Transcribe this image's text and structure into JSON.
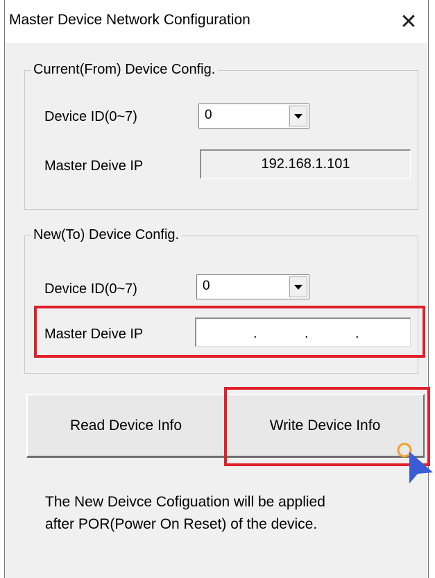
{
  "window": {
    "title": "Master Device Network Configuration",
    "close_glyph": "✕"
  },
  "current_group": {
    "legend": "Current(From) Device Config.",
    "device_id_label": "Device ID(0~7)",
    "device_id_value": "0",
    "master_ip_label": "Master Deive IP",
    "master_ip_value": "192.168.1.101"
  },
  "new_group": {
    "legend": "New(To) Device Config.",
    "device_id_label": "Device ID(0~7)",
    "device_id_value": "0",
    "master_ip_label": "Master Deive IP",
    "ip_separator": "."
  },
  "buttons": {
    "read": "Read Device Info",
    "write": "Write Device Info"
  },
  "note": {
    "line1": "The New Deivce Cofiguation will be applied",
    "line2": "after POR(Power On Reset) of the device."
  },
  "colors": {
    "highlight": "#e0202a",
    "cursor": "#3a5bd6",
    "click_ring": "#f0a030"
  }
}
